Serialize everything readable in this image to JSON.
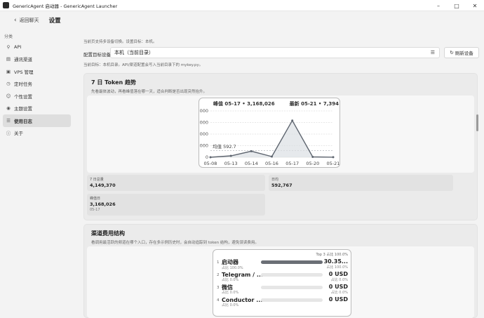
{
  "window": {
    "title": "GenericAgent 启动器 - GenericAgent Launcher"
  },
  "header": {
    "back_label": "返回聊天",
    "title": "设置"
  },
  "sidebar": {
    "heading": "分类",
    "items": [
      {
        "label": "API",
        "icon": "key-icon"
      },
      {
        "label": "通讯渠道",
        "icon": "chat-icon"
      },
      {
        "label": "VPS 管理",
        "icon": "server-icon"
      },
      {
        "label": "定时任务",
        "icon": "clock-icon"
      },
      {
        "label": "个性设置",
        "icon": "person-icon"
      },
      {
        "label": "主题设置",
        "icon": "palette-icon"
      },
      {
        "label": "使用日志",
        "icon": "log-icon",
        "active": true
      },
      {
        "label": "关于",
        "icon": "info-icon"
      }
    ]
  },
  "main": {
    "hint_top": "当前页支持多设备切换。设置目标：本机。",
    "config_label": "配置目标设备",
    "config_value": "本机（当前目录）",
    "refresh_label": "刷新设备",
    "hint_bottom": "当前目标：本机目录。API/渠道配置会写入当前目录下的 mykey.py。"
  },
  "token_section": {
    "title": "7 日 Token 趋势",
    "subtitle": "先看最体波动，再看峰值落在哪一天，适合判断是否出现突然抬升。",
    "stats": [
      {
        "label": "7 日总量",
        "value": "4,149,370",
        "sub": ""
      },
      {
        "label": "日均",
        "value": "592,767",
        "sub": ""
      },
      {
        "label": "峰值日",
        "value": "3,168,026",
        "sub": "05-17"
      }
    ]
  },
  "channel_section": {
    "title": "渠道费用结构",
    "subtitle": "看调用最活跃的频道在哪个入口，存在多示例历史时，会自动追踪到 token 结构，避免误读费用。",
    "top_label": "Top 3 占比 100.0%",
    "rows": [
      {
        "rank": "1",
        "name": "启动器",
        "value": "30.35...",
        "share_left": "占比 100.0%",
        "share_right": "占比 100.0%",
        "fill": 1.0
      },
      {
        "rank": "2",
        "name": "Telegram / ...",
        "value": "0 USD",
        "share_left": "占比 0.0%",
        "share_right": "占比 0.0%",
        "fill": 0.0
      },
      {
        "rank": "3",
        "name": "微信",
        "value": "0 USD",
        "share_left": "占比 0.0%",
        "share_right": "占比 0.0%",
        "fill": 0.0
      },
      {
        "rank": "4",
        "name": "Conductor ...",
        "value": "0 USD",
        "share_left": "占比 0.0%",
        "share_right": "",
        "fill": 0.0
      }
    ]
  },
  "chart_data": {
    "type": "line",
    "x": [
      "05-08",
      "05-13",
      "05-14",
      "05-16",
      "05-17",
      "05-20",
      "05-21"
    ],
    "series": [
      {
        "values": [
          0,
          120000,
          520000,
          60000,
          3168026,
          30000,
          7394
        ]
      }
    ],
    "annotations": {
      "peak": "峰值 05-17 • 3,168,026",
      "latest": "最新 05-21 • 7,394",
      "average": "均值 592.7"
    },
    "yticks": [
      "000",
      "000",
      "000",
      ".000",
      "0"
    ],
    "ylim": [
      0,
      4000000
    ],
    "grid": true,
    "colors": {
      "line": "#5f6670",
      "area": "#dcdfe4"
    }
  }
}
